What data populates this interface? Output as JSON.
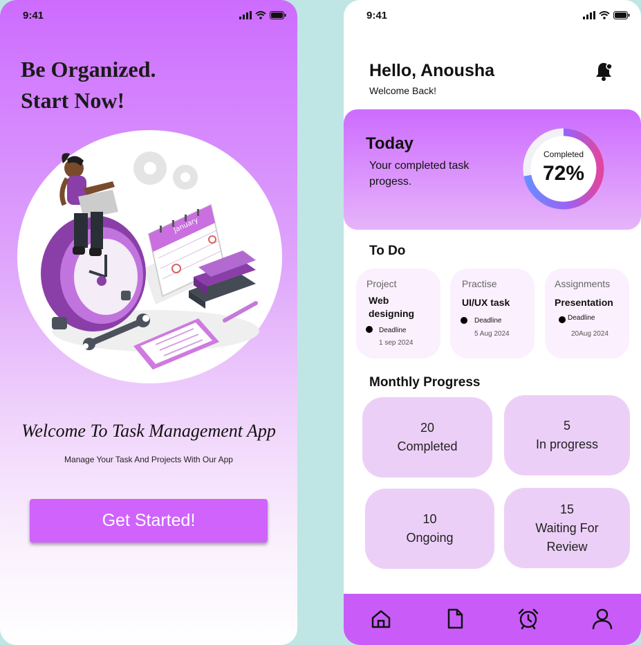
{
  "status_bar": {
    "time": "9:41"
  },
  "onboarding": {
    "headline_line1": "Be Organized.",
    "headline_line2": "Start Now!",
    "welcome_title": "Welcome To Task Management App",
    "subtitle": "Manage Your Task And Projects With Our App",
    "cta_label": "Get Started!",
    "calendar_month": "January"
  },
  "dashboard": {
    "greeting": "Hello, Anousha",
    "welcome_back": "Welcome Back!",
    "today": {
      "title": "Today",
      "subtitle": "Your completed task progess.",
      "completed_label": "Completed",
      "completed_value": "72%",
      "completed_fraction": 0.72
    },
    "todo_title": "To Do",
    "todo": [
      {
        "category": "Project",
        "task": "Web designing",
        "deadline_label": "Deadline",
        "date": "1 sep 2024"
      },
      {
        "category": "Practise",
        "task": "UI/UX task",
        "deadline_label": "Deadline",
        "date": "5 Aug 2024"
      },
      {
        "category": "Assignments",
        "task": "Presentation",
        "deadline_label": "Deadline",
        "date": "20Aug 2024"
      }
    ],
    "monthly_title": "Monthly Progress",
    "monthly": [
      {
        "count": "20",
        "label": "Completed"
      },
      {
        "count": "5",
        "label": "In progress"
      },
      {
        "count": "10",
        "label": "Ongoing"
      },
      {
        "count": "15",
        "label": "Waiting For",
        "label2": "Review"
      }
    ],
    "nav": [
      "home-icon",
      "document-icon",
      "alarm-icon",
      "profile-icon"
    ]
  },
  "colors": {
    "primary": "#c95cf8",
    "card": "#eccff7",
    "todo_card": "#fbf0fd",
    "background": "#bfe6e4"
  }
}
